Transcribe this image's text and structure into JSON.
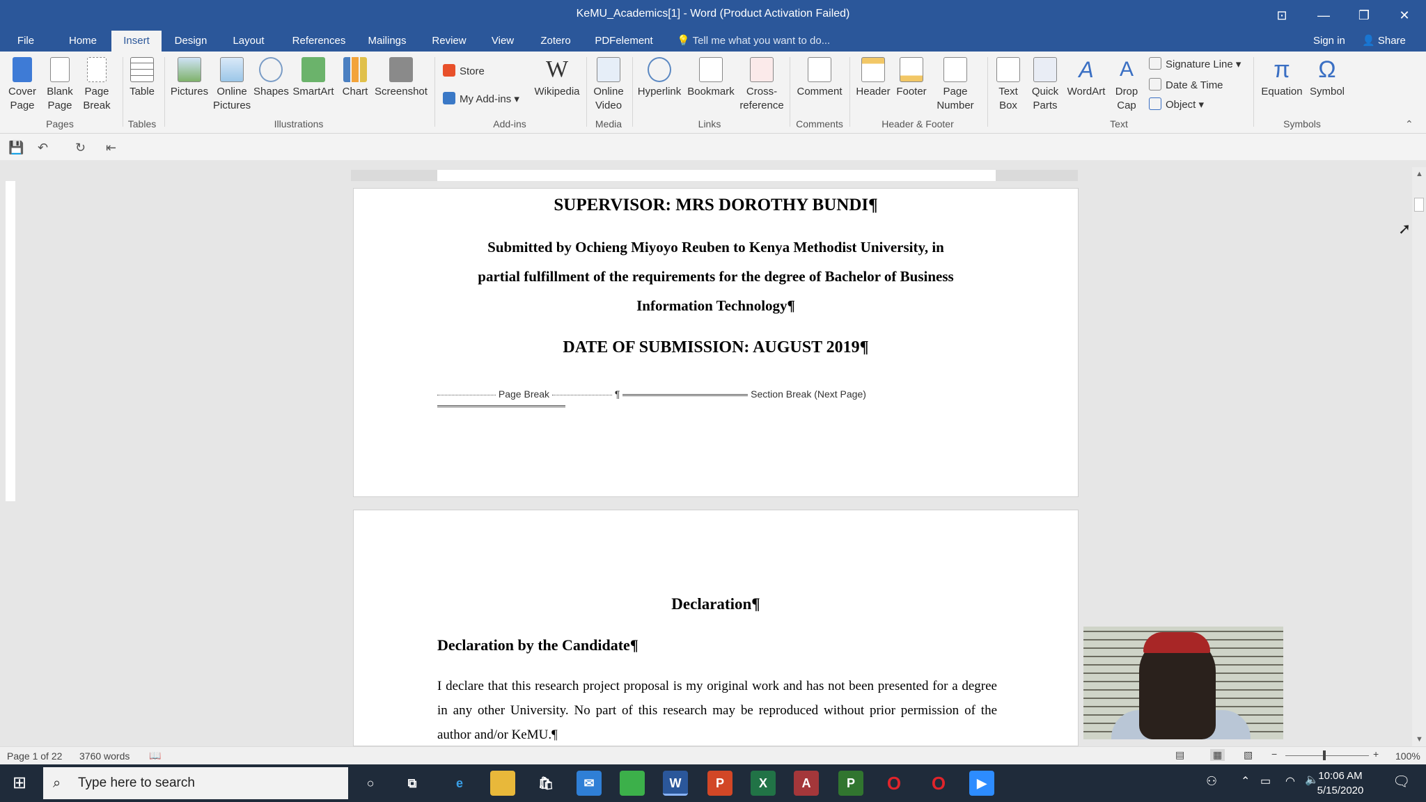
{
  "window": {
    "title": "KeMU_Academics[1] - Word (Product Activation Failed)"
  },
  "tabs": [
    "File",
    "Home",
    "Insert",
    "Design",
    "Layout",
    "References",
    "Mailings",
    "Review",
    "View",
    "Zotero",
    "PDFelement"
  ],
  "active_tab": "Insert",
  "tell_me": "Tell me what you want to do...",
  "sign_in": "Sign in",
  "share": "Share",
  "ribbon": {
    "cover_page": "Cover Page",
    "blank_page": "Blank Page",
    "page_break": "Page Break",
    "table": "Table",
    "pictures": "Pictures",
    "online_pictures": "Online Pictures",
    "shapes": "Shapes",
    "smartart": "SmartArt",
    "chart": "Chart",
    "screenshot": "Screenshot",
    "store": "Store",
    "my_addins": "My Add-ins",
    "wikipedia": "Wikipedia",
    "online_video": "Online Video",
    "hyperlink": "Hyperlink",
    "bookmark": "Bookmark",
    "cross_reference": "Cross-reference",
    "comment": "Comment",
    "header": "Header",
    "footer": "Footer",
    "page_number": "Page Number",
    "text_box": "Text Box",
    "quick_parts": "Quick Parts",
    "wordart": "WordArt",
    "drop_cap": "Drop Cap",
    "signature_line": "Signature Line",
    "date_time": "Date & Time",
    "object": "Object",
    "equation": "Equation",
    "symbol": "Symbol",
    "groups": {
      "pages": "Pages",
      "tables": "Tables",
      "illustrations": "Illustrations",
      "addins": "Add-ins",
      "media": "Media",
      "links": "Links",
      "comments": "Comments",
      "header_footer": "Header & Footer",
      "text": "Text",
      "symbols": "Symbols"
    }
  },
  "document": {
    "supervisor": "SUPERVISOR: MRS DOROTHY BUNDI¶",
    "submitted_line1": "Submitted by Ochieng Miyoyo Reuben to Kenya Methodist University, in",
    "submitted_line2": "partial fulfillment of the requirements for the degree of Bachelor of Business",
    "submitted_line3": "Information Technology¶",
    "date": "DATE OF SUBMISSION: AUGUST 2019¶",
    "page_break": "Page Break",
    "section_break": "Section Break (Next Page)",
    "declaration_title": "Declaration¶",
    "declaration_by": "Declaration by the Candidate¶",
    "declaration_text": "I declare that this research project proposal is my original work and has not been presented for a degree in any other University. No part of this research may be reproduced without prior permission of the author and/or KeMU.¶"
  },
  "status": {
    "page": "Page 1 of 22",
    "words": "3760 words",
    "zoom": "100%"
  },
  "taskbar": {
    "search_placeholder": "Type here to search",
    "time": "10:06 AM",
    "date": "5/15/2020"
  },
  "colors": {
    "accent": "#2b579a",
    "taskbar": "#1f2b3a"
  }
}
